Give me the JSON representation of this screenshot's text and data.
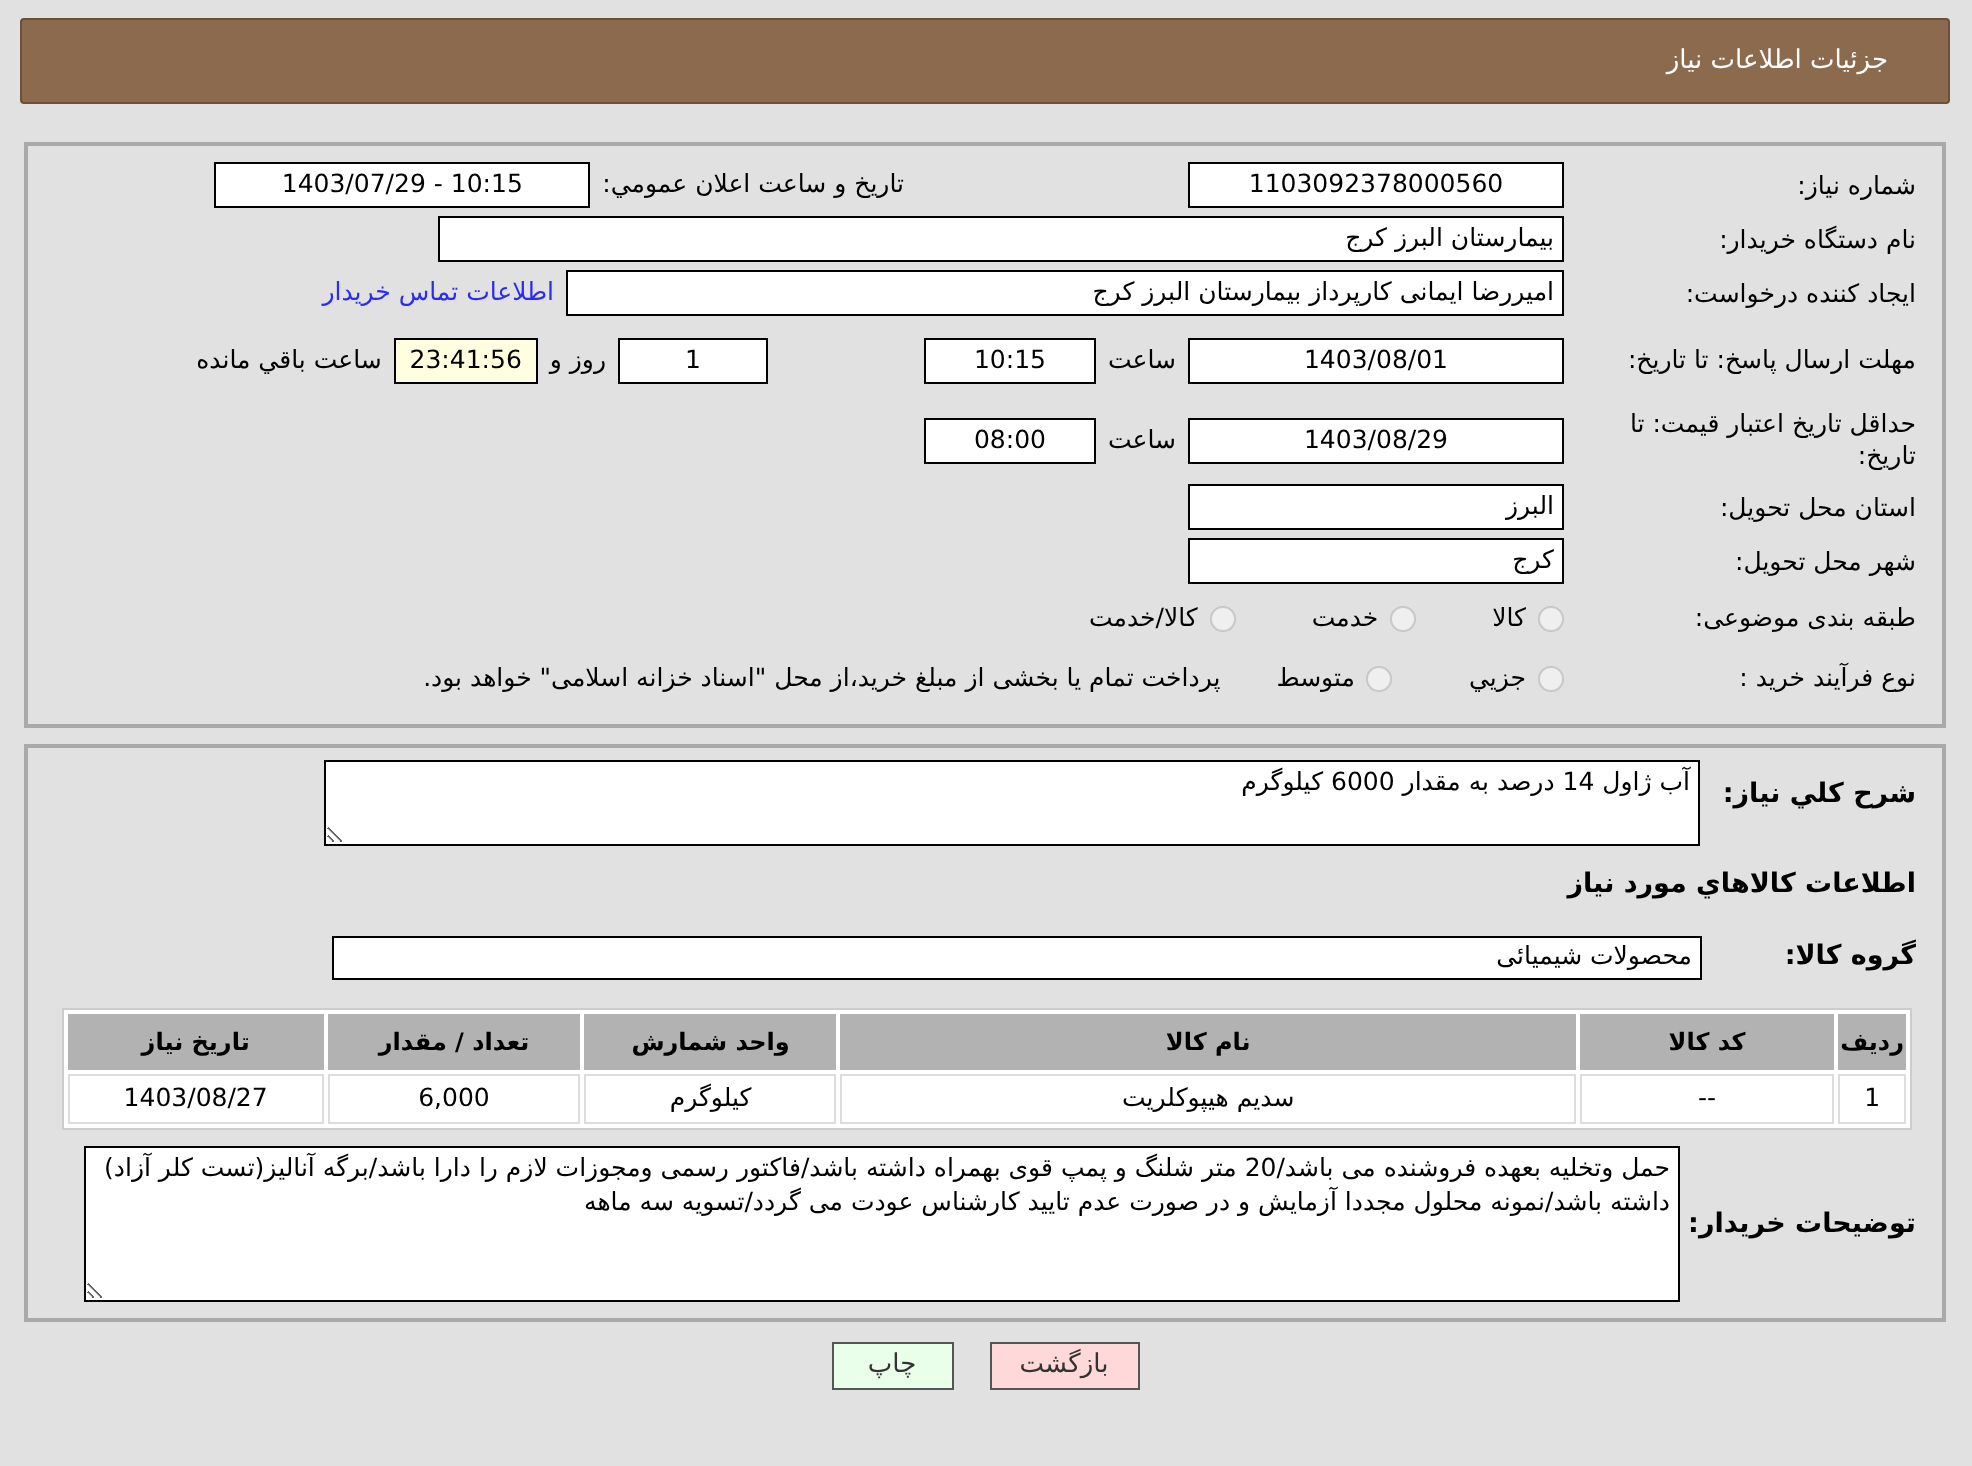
{
  "header": {
    "title": "جزئیات اطلاعات نیاز"
  },
  "need_number": {
    "label": "شماره نیاز:",
    "value": "1103092378000560"
  },
  "announce": {
    "label": "تاريخ و ساعت اعلان عمومي:",
    "value": "1403/07/29 - 10:15"
  },
  "buyer_org": {
    "label": "نام دستگاه خریدار:",
    "value": "بیمارستان البرز کرج"
  },
  "requester": {
    "label": "ایجاد کننده درخواست:",
    "value": "امیررضا ایمانی کارپرداز بیمارستان البرز کرج",
    "link": "اطلاعات تماس خريدار"
  },
  "response_deadline": {
    "label": "مهلت ارسال پاسخ: تا تاریخ:",
    "date": "1403/08/01",
    "time_label": "ساعت",
    "time": "10:15",
    "days": "1",
    "days_label": "روز و",
    "remaining": "23:41:56",
    "remaining_label": "ساعت باقي مانده"
  },
  "price_validity": {
    "label": "حداقل تاریخ اعتبار قیمت: تا تاریخ:",
    "date": "1403/08/29",
    "time_label": "ساعت",
    "time": "08:00"
  },
  "province": {
    "label": "استان محل تحویل:",
    "value": "البرز"
  },
  "city": {
    "label": "شهر محل تحویل:",
    "value": "کرج"
  },
  "category": {
    "label": "طبقه بندی موضوعی:",
    "options": [
      {
        "label": "کالا",
        "selected": false
      },
      {
        "label": "خدمت",
        "selected": false
      },
      {
        "label": "کالا/خدمت",
        "selected": false
      }
    ]
  },
  "purchase_type": {
    "label": "نوع فرآیند خرید :",
    "options": [
      {
        "label": "جزيي",
        "selected": false
      },
      {
        "label": "متوسط",
        "selected": false
      }
    ],
    "note": "پرداخت تمام یا بخشی از مبلغ خرید،از محل \"اسناد خزانه اسلامی\" خواهد بود."
  },
  "description": {
    "label": "شرح کلي نياز:",
    "value": "آب ژاول 14 درصد به مقدار 6000 کیلوگرم"
  },
  "goods_heading": "اطلاعات كالاهاي مورد نياز",
  "goods_group": {
    "label": "گروه کالا:",
    "value": "محصولات شیمیائی"
  },
  "table": {
    "columns": [
      "ردیف",
      "کد کالا",
      "نام کالا",
      "واحد شمارش",
      "تعداد / مقدار",
      "تاريخ نياز"
    ],
    "rows": [
      [
        "1",
        "--",
        "سدیم هیپوکلریت",
        "کیلوگرم",
        "6,000",
        "1403/08/27"
      ]
    ]
  },
  "buyer_notes": {
    "label": "توضیحات خریدار:",
    "value": "حمل وتخلیه بعهده فروشنده می باشد/20 متر شلنگ و پمپ قوی بهمراه داشته باشد/فاکتور رسمی ومجوزات لازم را دارا باشد/برگه آنالیز(تست کلر آزاد) داشته باشد/نمونه محلول مجددا آزمایش و در صورت عدم تایید کارشناس عودت می گردد/تسویه سه ماهه"
  },
  "buttons": [
    {
      "label": "بازگشت",
      "kind": "back"
    },
    {
      "label": "چاپ",
      "kind": "print"
    }
  ]
}
